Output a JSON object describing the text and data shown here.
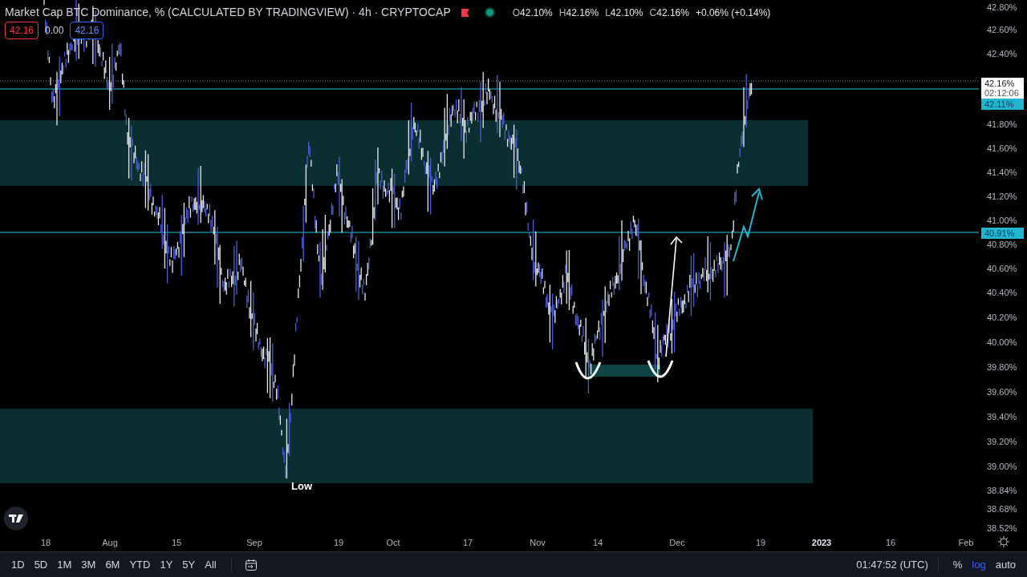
{
  "header": {
    "title": "Market Cap BTC Dominance, % (CALCULATED BY TRADINGVIEW) · 4h · CRYPTOCAP",
    "ohlc": [
      {
        "label": "O",
        "value": "42.10%"
      },
      {
        "label": "H",
        "value": "42.16%"
      },
      {
        "label": "L",
        "value": "42.10%"
      },
      {
        "label": "C",
        "value": "42.16%"
      }
    ],
    "change": "+0.06% (+0.14%)",
    "badges": [
      {
        "kind": "sell",
        "text": "42.16"
      },
      {
        "kind": "spread",
        "text": "0.00"
      },
      {
        "kind": "buy",
        "text": "42.16"
      }
    ]
  },
  "chart": {
    "annotation": "Low",
    "price_axis": [
      "42.80%",
      "42.60%",
      "42.40%",
      "41.80%",
      "41.60%",
      "41.40%",
      "41.20%",
      "41.00%",
      "40.80%",
      "40.60%",
      "40.40%",
      "40.20%",
      "40.00%",
      "39.80%",
      "39.60%",
      "39.40%",
      "39.20%",
      "39.00%",
      "38.84%",
      "38.68%",
      "38.52%"
    ],
    "price_flags": [
      {
        "kind": "last",
        "text": "42.16%",
        "countdown": "02:12:06"
      },
      {
        "kind": "line",
        "text": "42.11%"
      },
      {
        "kind": "line",
        "text": "40.91%"
      }
    ],
    "time_axis": [
      {
        "kind": "day",
        "text": "18"
      },
      {
        "kind": "month",
        "text": "Aug"
      },
      {
        "kind": "day",
        "text": "15"
      },
      {
        "kind": "month",
        "text": "Sep"
      },
      {
        "kind": "day",
        "text": "19"
      },
      {
        "kind": "month",
        "text": "Oct"
      },
      {
        "kind": "day",
        "text": "17"
      },
      {
        "kind": "month",
        "text": "Nov"
      },
      {
        "kind": "day",
        "text": "14"
      },
      {
        "kind": "month",
        "text": "Dec"
      },
      {
        "kind": "day",
        "text": "19"
      },
      {
        "kind": "year",
        "text": "2023"
      },
      {
        "kind": "day",
        "text": "16"
      },
      {
        "kind": "month",
        "text": "Feb"
      }
    ]
  },
  "toolbar": {
    "ranges": [
      "1D",
      "5D",
      "1M",
      "3M",
      "6M",
      "YTD",
      "1Y",
      "5Y",
      "All"
    ],
    "clock": "01:47:52 (UTC)",
    "scale_options": [
      {
        "label": "%",
        "selected": false
      },
      {
        "label": "log",
        "selected": true
      },
      {
        "label": "auto",
        "selected": false
      }
    ]
  }
}
